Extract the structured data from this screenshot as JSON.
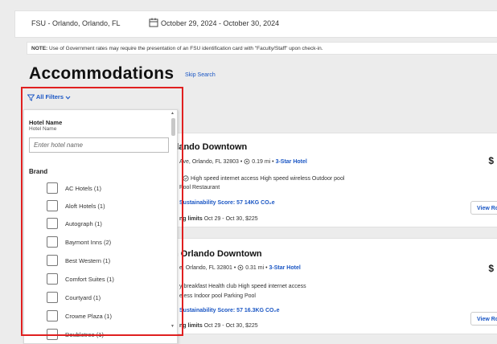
{
  "search": {
    "location": "FSU - Orlando, Orlando, FL",
    "dates": "October 29, 2024 - October 30, 2024"
  },
  "note": {
    "label": "NOTE:",
    "text": "Use of Government rates may require the presentation of an FSU identification card with \"Faculty/Staff\" upon check-in."
  },
  "heading": "Accommodations",
  "skip_search": "Skip Search",
  "filters": {
    "link_label": "All Filters",
    "hotel_name_title": "Hotel Name",
    "hotel_name_sub": "Hotel Name",
    "hotel_name_placeholder": "Enter hotel name",
    "brand_title": "Brand",
    "brands": [
      "AC Hotels (1)",
      "Aloft Hotels (1)",
      "Autograph (1)",
      "Baymont Inns (2)",
      "Best Western (1)",
      "Comfort Suites (1)",
      "Courtyard (1)",
      "Crowne Plaza (1)",
      "Doubletree (1)"
    ]
  },
  "results": [
    {
      "name": "rlando Downtown",
      "address": "Ave, Orlando, FL 32803 •",
      "distance": "0.19 mi •",
      "star": "3-Star Hotel",
      "amenities_1": "High speed internet access   High speed wireless   Outdoor pool",
      "amenities_2": "Pool   Restaurant",
      "sustainability": "Sustainability Score: 57    14KG CO₂e",
      "limits_label": "ng limits",
      "limits_text": "Oct 29 - Oct 30, $225",
      "price": "$",
      "view_button": "View Ro"
    },
    {
      "name": "n Orlando Downtown",
      "address": "e, Orlando, FL 32801 •",
      "distance": "0.31 mi •",
      "star": "3-Star Hotel",
      "amenities_1": "y breakfast   Health club   High speed internet access",
      "amenities_2": "eless   Indoor pool   Parking   Pool",
      "sustainability": "Sustainability Score: 57    16.3KG CO₂e",
      "limits_label": "ng limits",
      "limits_text": "Oct 29 - Oct 30, $225",
      "price": "$",
      "view_button": "View Ro"
    }
  ]
}
